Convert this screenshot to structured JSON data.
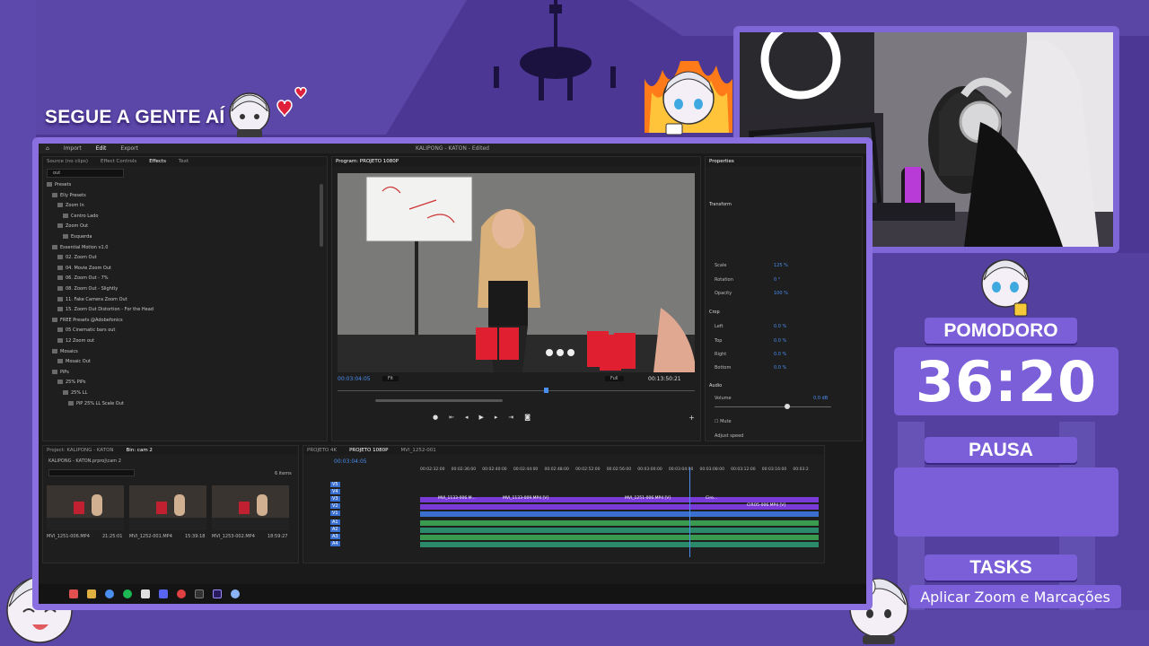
{
  "overlay": {
    "follow_text": "SEGUE A GENTE AÍ",
    "pomodoro_label": "POMODORO",
    "timer": "36:20",
    "pause_label": "PAUSA",
    "tasks_label": "TASKS",
    "task_text": "Aplicar Zoom e Marcações"
  },
  "premiere": {
    "menu": [
      "Import",
      "Edit",
      "Export"
    ],
    "active_menu": "Edit",
    "window_title": "KALIPONG - KATON - Edited",
    "left_panel_tabs": [
      "Source (no clips)",
      "Effect Controls",
      "Effects",
      "Text"
    ],
    "search_value": "out",
    "effects_tree": [
      "Presets",
      "Elly Presets",
      "Zoom In",
      "Centro Lado",
      "Zoom Out",
      "Esquerda",
      "Essential Motion v1.0",
      "02. Zoom Out",
      "04. Movie Zoom Out",
      "06. Zoom Out - 7%",
      "08. Zoom Out - Slightly",
      "11. Fake Camera Zoom Out",
      "15. Zoom Out Distortion - For the Head",
      "FREE Presets @Adobefonics",
      "05 Cinematic bars out",
      "12 Zoom out",
      "Mosaics",
      "Mosaic Out",
      "PiPs",
      "25% PiPs",
      "25% LL",
      "PiP 25% LL Scale Out"
    ],
    "program_title": "Program: PROJETO 1080P",
    "program_timecode": "00:03:04:05",
    "program_fit": "Fit",
    "program_full": "Full",
    "program_duration": "00:13:50:21",
    "properties_tab": "Properties",
    "properties": {
      "transform": "Transform",
      "scale_label": "Scale",
      "scale_value": "125 %",
      "rotation_label": "Rotation",
      "rotation_value": "0 °",
      "opacity_label": "Opacity",
      "opacity_value": "100 %",
      "crop": "Crop",
      "left": "Left",
      "top": "Top",
      "right": "Right",
      "bottom": "Bottom",
      "crop_value": "0.0 %",
      "audio": "Audio",
      "volume": "Volume",
      "volume_value": "0.0 dB",
      "mute": "Mute",
      "adjust_speed": "Adjust speed"
    },
    "project_tabs": [
      "Project: KALIPONG - KATON",
      "Bin: cam 2"
    ],
    "project_path": "KALIPONG - KATON.prproj\\cam 2",
    "items_count": "6 items",
    "bin_clips": [
      {
        "name": "MVI_1251-006.MP4",
        "duration": "21:25:01"
      },
      {
        "name": "MVI_1252-001.MP4",
        "duration": "15:39:18"
      },
      {
        "name": "MVI_1253-002.MP4",
        "duration": "18:59:27"
      }
    ],
    "timeline_tabs": [
      "PROJETO 4K",
      "PROJETO 1080P",
      "MVI_1252-001"
    ],
    "timeline_timecode": "00:03:04:05",
    "ruler": [
      "00:02:32:00",
      "00:02:36:00",
      "00:02:40:00",
      "00:02:44:00",
      "00:02:48:00",
      "00:02:52:00",
      "00:02:56:00",
      "00:03:00:00",
      "00:03:04:00",
      "00:03:08:00",
      "00:03:12:00",
      "00:03:16:00",
      "00:03:2"
    ],
    "tracks_video": [
      "V5",
      "V4",
      "V3",
      "V2",
      "V1"
    ],
    "tracks_audio": [
      "A1",
      "A2",
      "A3",
      "A4"
    ],
    "clip_labels": [
      "MVI_1133-006.M...",
      "MVI_1133-009.MP4 [V]",
      "MVI_1133-006.MP4 [V]",
      "MVI_1251-006.MP4 [V]",
      "Ciro...",
      "CIRO5-006.MP4 [V]",
      "CIRO5"
    ]
  },
  "colors": {
    "overlay_purple": "#7a5fd8",
    "premiere_blue": "#4a8ef0"
  }
}
